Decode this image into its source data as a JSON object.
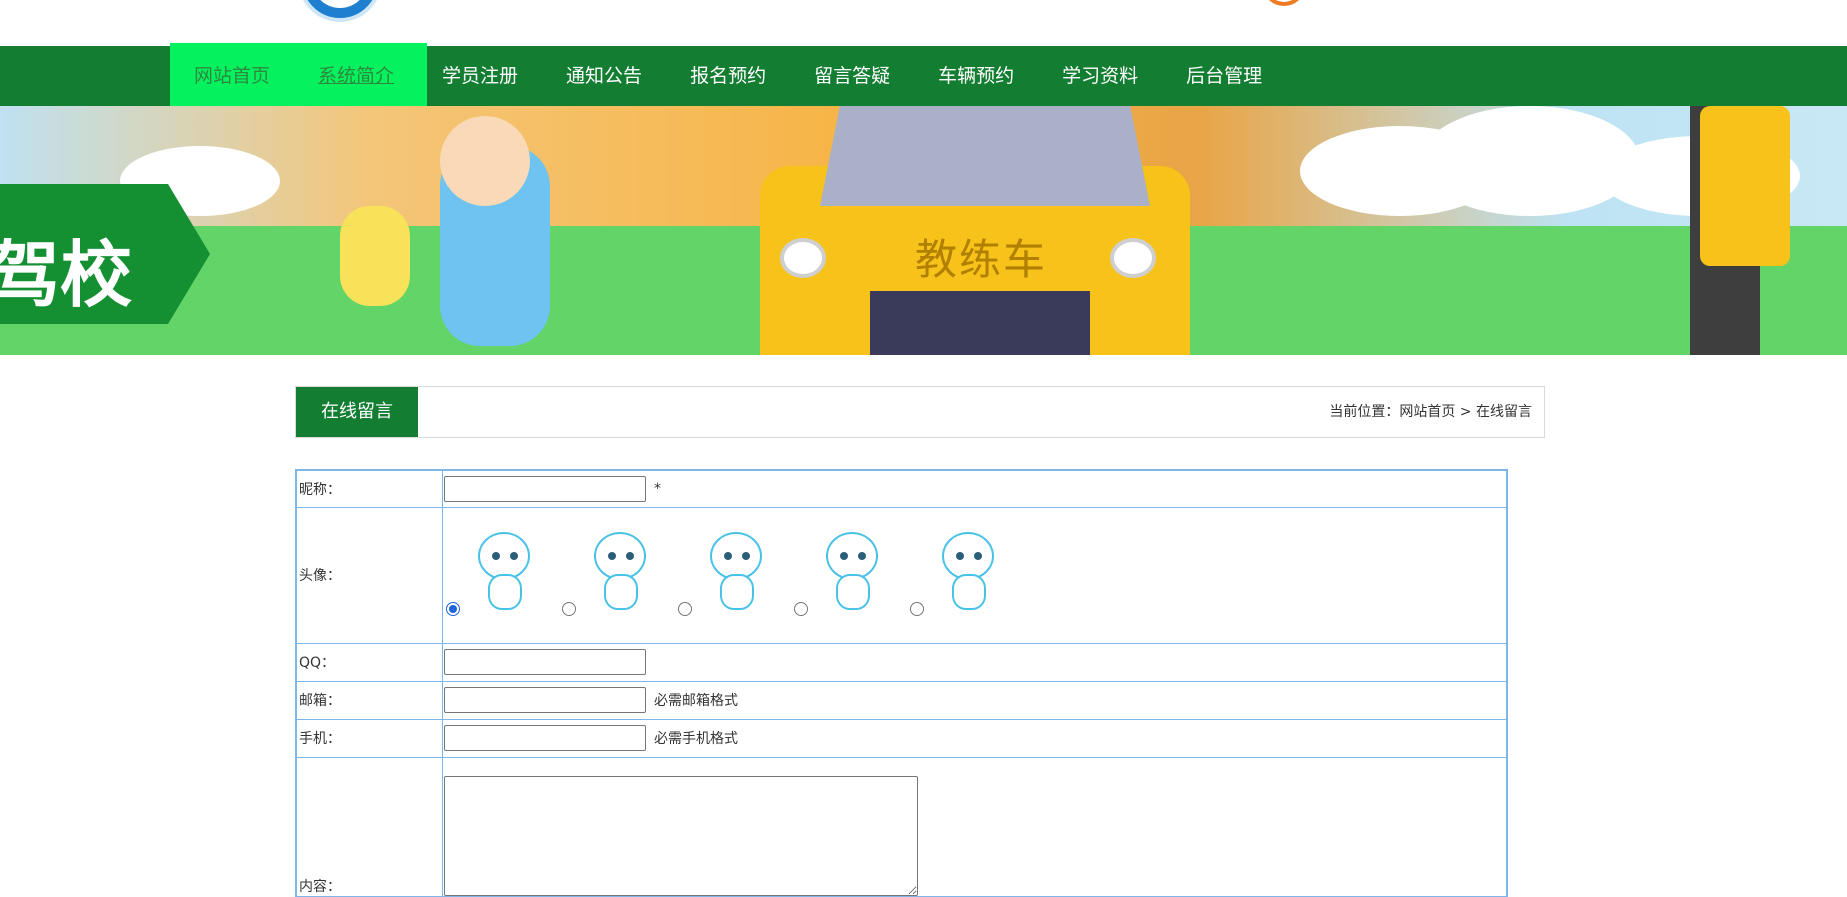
{
  "header": {
    "site_name": "",
    "phone": ""
  },
  "nav": {
    "items": [
      {
        "label": "网站首页"
      },
      {
        "label": "系统简介"
      },
      {
        "label": "学员注册"
      },
      {
        "label": "通知公告"
      },
      {
        "label": "报名预约"
      },
      {
        "label": "留言答疑"
      },
      {
        "label": "车辆预约"
      },
      {
        "label": "学习资料"
      },
      {
        "label": "后台管理"
      }
    ]
  },
  "banner": {
    "sign_text": "驾校",
    "car_text": "教练车"
  },
  "section": {
    "title": "在线留言",
    "breadcrumb": "当前位置：网站首页 > 在线留言"
  },
  "form": {
    "nickname_label": "昵称：",
    "nickname_value": "",
    "required_mark": "*",
    "avatar_label": "头像：",
    "avatar_selected_index": 0,
    "avatar_count": 5,
    "qq_label": "QQ：",
    "qq_value": "",
    "email_label": "邮箱：",
    "email_value": "",
    "email_hint": "必需邮箱格式",
    "phone_label": "手机：",
    "phone_value": "",
    "phone_hint": "必需手机格式",
    "content_label": "内容：",
    "content_value": ""
  },
  "colors": {
    "nav_bg": "#137d32",
    "nav_active_bg": "#05f25e",
    "table_border": "#7fb6ea",
    "accent_orange": "#f07b22"
  }
}
